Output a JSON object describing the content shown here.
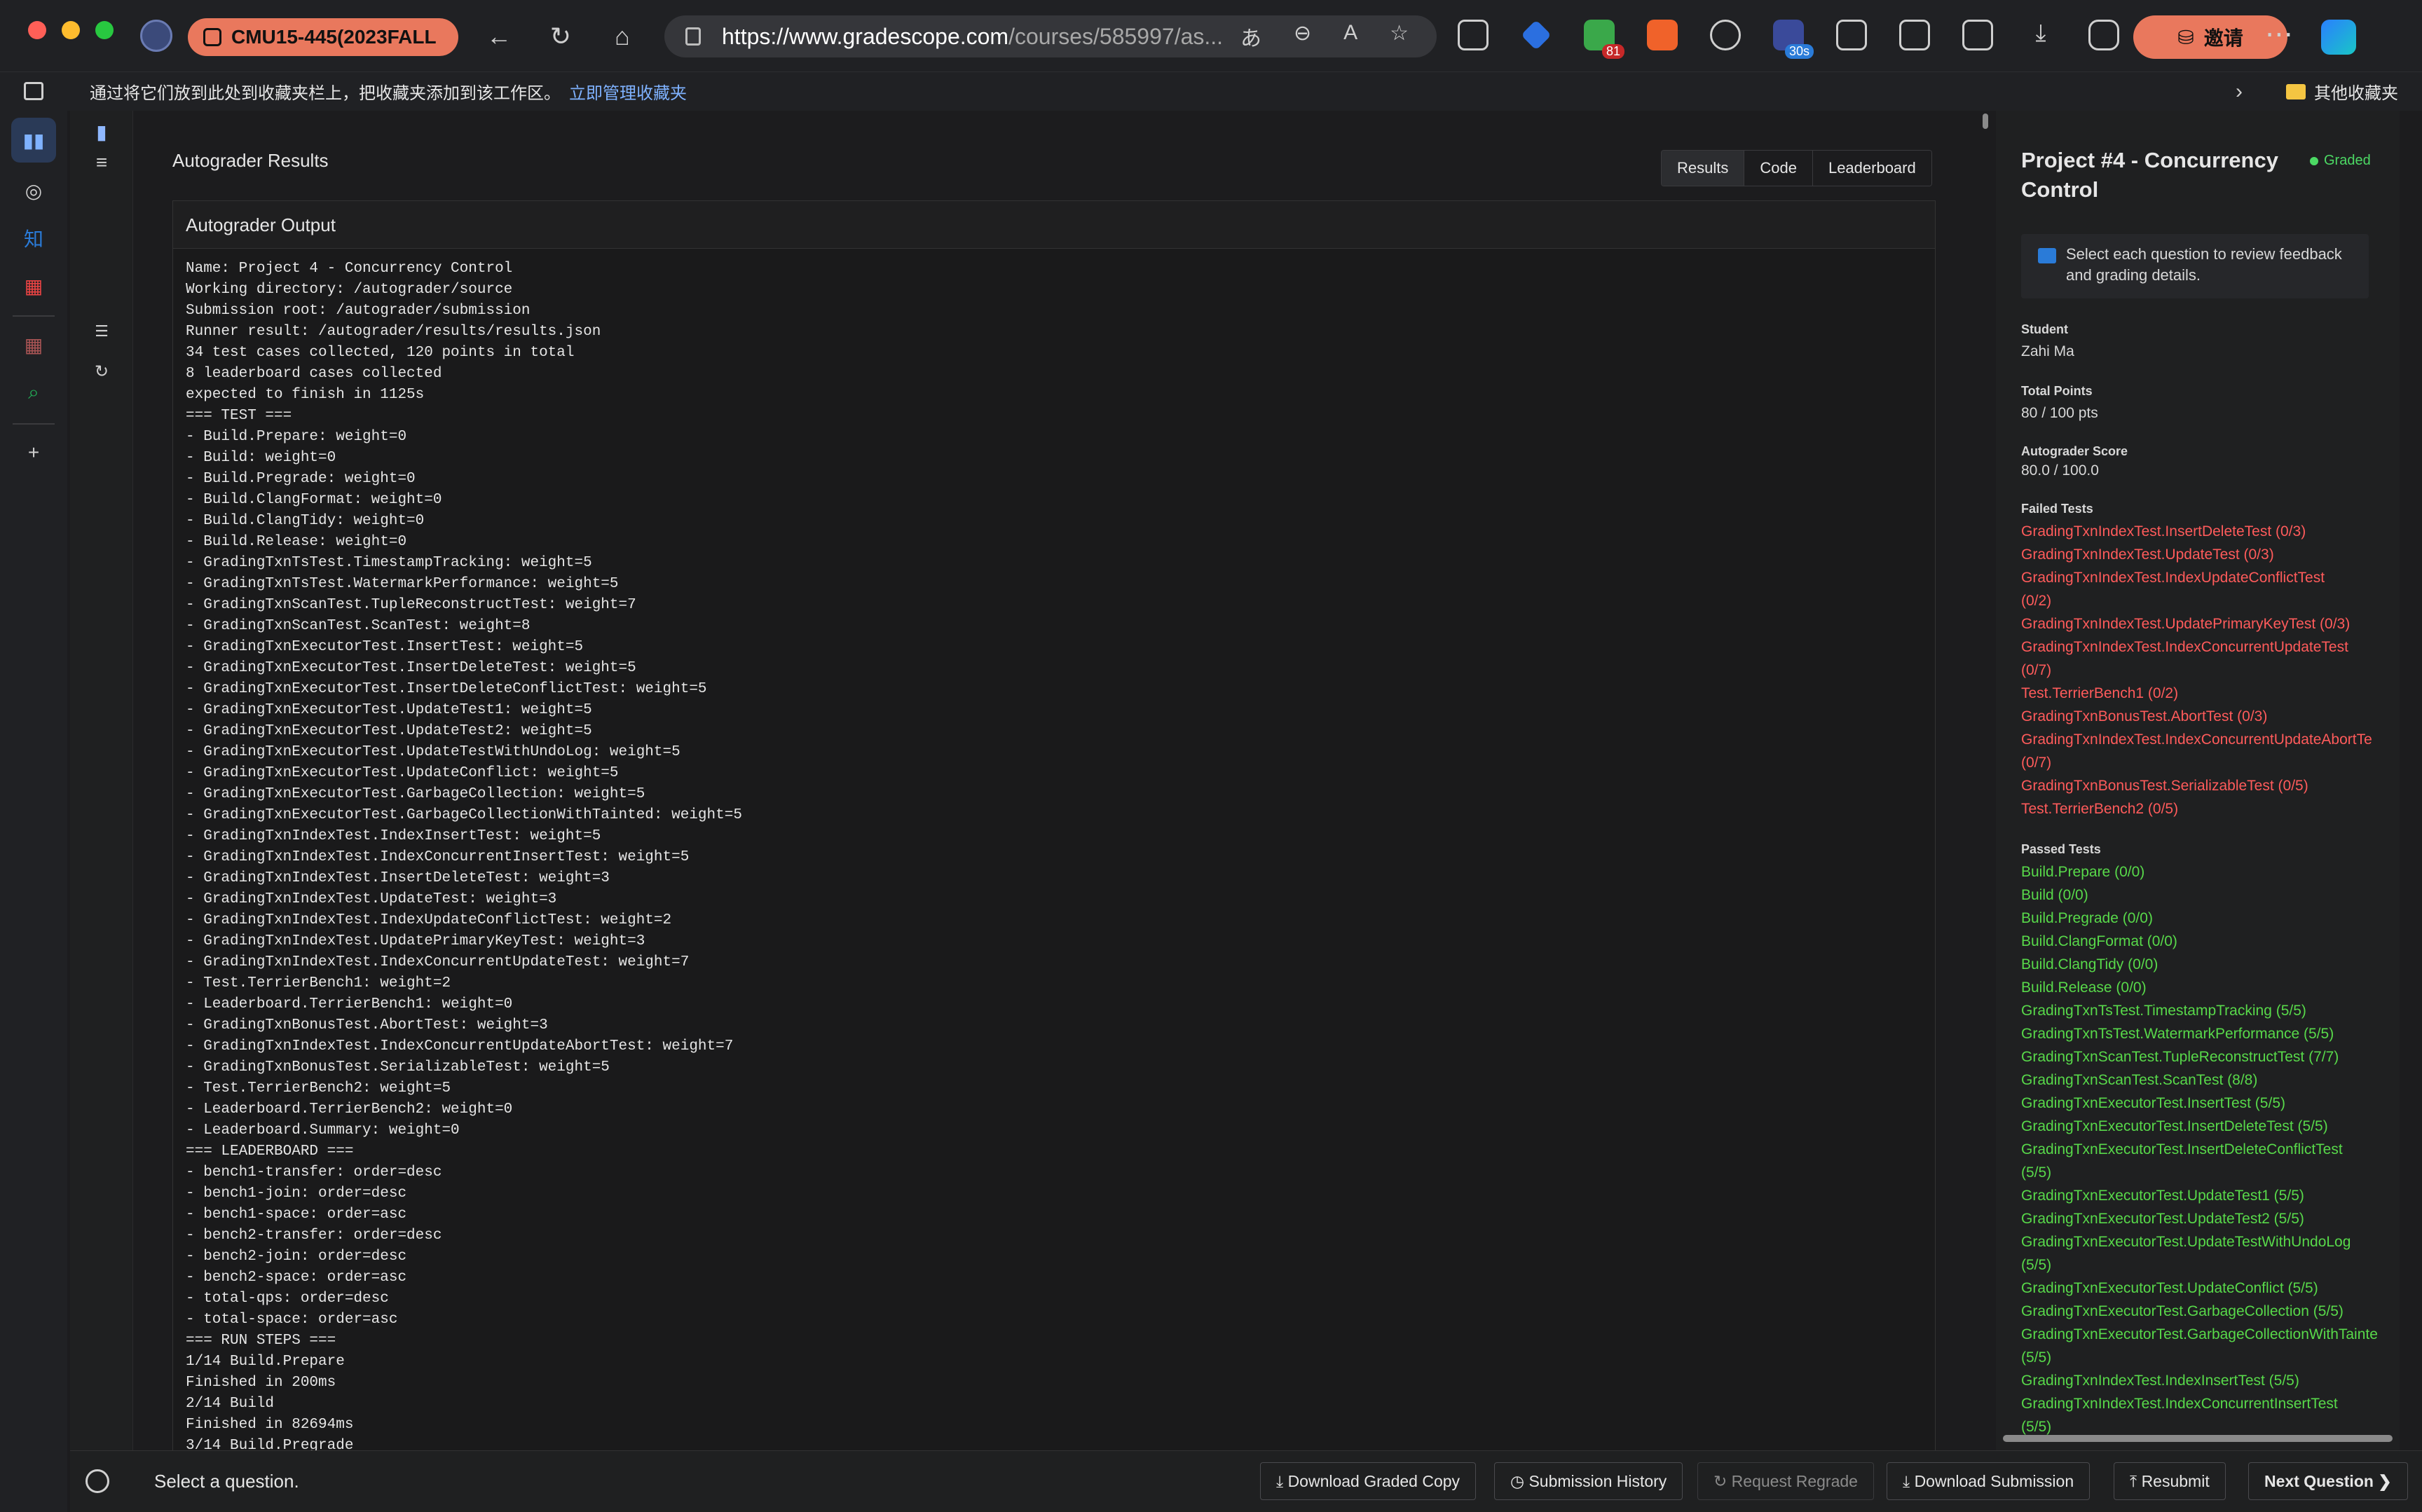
{
  "browser": {
    "tab_title": "CMU15-445(2023FALL",
    "url_host": "https://www.gradescope.com",
    "url_path": "/courses/585997/as...",
    "ext_badge": "81",
    "ext_timer": "30s",
    "invite_label": "邀请"
  },
  "favorites": {
    "message": "通过将它们放到此处到收藏夹栏上，把收藏夹添加到该工作区。",
    "manage_link": "立即管理收藏夹",
    "other_folder": "其他收藏夹"
  },
  "main": {
    "title": "Autograder Results",
    "tabs": [
      {
        "label": "Results"
      },
      {
        "label": "Code"
      },
      {
        "label": "Leaderboard"
      }
    ],
    "panel_title": "Autograder Output",
    "output_lines": [
      "Name: Project 4 - Concurrency Control",
      "Working directory: /autograder/source",
      "Submission root: /autograder/submission",
      "Runner result: /autograder/results/results.json",
      "34 test cases collected, 120 points in total",
      "8 leaderboard cases collected",
      "expected to finish in 1125s",
      "=== TEST ===",
      "- Build.Prepare: weight=0",
      "- Build: weight=0",
      "- Build.Pregrade: weight=0",
      "- Build.ClangFormat: weight=0",
      "- Build.ClangTidy: weight=0",
      "- Build.Release: weight=0",
      "- GradingTxnTsTest.TimestampTracking: weight=5",
      "- GradingTxnTsTest.WatermarkPerformance: weight=5",
      "- GradingTxnScanTest.TupleReconstructTest: weight=7",
      "- GradingTxnScanTest.ScanTest: weight=8",
      "- GradingTxnExecutorTest.InsertTest: weight=5",
      "- GradingTxnExecutorTest.InsertDeleteTest: weight=5",
      "- GradingTxnExecutorTest.InsertDeleteConflictTest: weight=5",
      "- GradingTxnExecutorTest.UpdateTest1: weight=5",
      "- GradingTxnExecutorTest.UpdateTest2: weight=5",
      "- GradingTxnExecutorTest.UpdateTestWithUndoLog: weight=5",
      "- GradingTxnExecutorTest.UpdateConflict: weight=5",
      "- GradingTxnExecutorTest.GarbageCollection: weight=5",
      "- GradingTxnExecutorTest.GarbageCollectionWithTainted: weight=5",
      "- GradingTxnIndexTest.IndexInsertTest: weight=5",
      "- GradingTxnIndexTest.IndexConcurrentInsertTest: weight=5",
      "- GradingTxnIndexTest.InsertDeleteTest: weight=3",
      "- GradingTxnIndexTest.UpdateTest: weight=3",
      "- GradingTxnIndexTest.IndexUpdateConflictTest: weight=2",
      "- GradingTxnIndexTest.UpdatePrimaryKeyTest: weight=3",
      "- GradingTxnIndexTest.IndexConcurrentUpdateTest: weight=7",
      "- Test.TerrierBench1: weight=2",
      "- Leaderboard.TerrierBench1: weight=0",
      "- GradingTxnBonusTest.AbortTest: weight=3",
      "- GradingTxnIndexTest.IndexConcurrentUpdateAbortTest: weight=7",
      "- GradingTxnBonusTest.SerializableTest: weight=5",
      "- Test.TerrierBench2: weight=5",
      "- Leaderboard.TerrierBench2: weight=0",
      "- Leaderboard.Summary: weight=0",
      "=== LEADERBOARD ===",
      "- bench1-transfer: order=desc",
      "- bench1-join: order=desc",
      "- bench1-space: order=asc",
      "- bench2-transfer: order=desc",
      "- bench2-join: order=desc",
      "- bench2-space: order=asc",
      "- total-qps: order=desc",
      "- total-space: order=asc",
      "=== RUN STEPS ===",
      "1/14 Build.Prepare",
      "Finished in 200ms",
      "2/14 Build",
      "Finished in 82694ms",
      "3/14 Build.Pregrade"
    ]
  },
  "side": {
    "title": "Project #4 - Concurrency Control",
    "status": "Graded",
    "notice": "Select each question to review feedback and grading details.",
    "student_label": "Student",
    "student_value": "Zahi Ma",
    "total_label": "Total Points",
    "total_value": "80 / 100 pts",
    "autograder_label": "Autograder Score",
    "autograder_value": "80.0 / 100.0",
    "failed_label": "Failed Tests",
    "failed_tests": [
      "GradingTxnIndexTest.InsertDeleteTest (0/3)",
      "GradingTxnIndexTest.UpdateTest (0/3)",
      "GradingTxnIndexTest.IndexUpdateConflictTest",
      "(0/2)",
      "GradingTxnIndexTest.UpdatePrimaryKeyTest (0/3)",
      "GradingTxnIndexTest.IndexConcurrentUpdateTest",
      "(0/7)",
      "Test.TerrierBench1 (0/2)",
      "GradingTxnBonusTest.AbortTest (0/3)",
      "GradingTxnIndexTest.IndexConcurrentUpdateAbortTe",
      "(0/7)",
      "GradingTxnBonusTest.SerializableTest (0/5)",
      "Test.TerrierBench2 (0/5)"
    ],
    "passed_label": "Passed Tests",
    "passed_tests": [
      "Build.Prepare (0/0)",
      "Build (0/0)",
      "Build.Pregrade (0/0)",
      "Build.ClangFormat (0/0)",
      "Build.ClangTidy (0/0)",
      "Build.Release (0/0)",
      "GradingTxnTsTest.TimestampTracking (5/5)",
      "GradingTxnTsTest.WatermarkPerformance (5/5)",
      "GradingTxnScanTest.TupleReconstructTest (7/7)",
      "GradingTxnScanTest.ScanTest (8/8)",
      "GradingTxnExecutorTest.InsertTest (5/5)",
      "GradingTxnExecutorTest.InsertDeleteTest (5/5)",
      "GradingTxnExecutorTest.InsertDeleteConflictTest",
      "(5/5)",
      "GradingTxnExecutorTest.UpdateTest1 (5/5)",
      "GradingTxnExecutorTest.UpdateTest2 (5/5)",
      "GradingTxnExecutorTest.UpdateTestWithUndoLog",
      "(5/5)",
      "GradingTxnExecutorTest.UpdateConflict (5/5)",
      "GradingTxnExecutorTest.GarbageCollection (5/5)",
      "GradingTxnExecutorTest.GarbageCollectionWithTainte",
      "(5/5)",
      "GradingTxnIndexTest.IndexInsertTest (5/5)",
      "GradingTxnIndexTest.IndexConcurrentInsertTest",
      "(5/5)"
    ]
  },
  "bottom": {
    "select_prompt": "Select a question.",
    "download_graded": "Download Graded Copy",
    "submission_history": "Submission History",
    "request_regrade": "Request Regrade",
    "download_submission": "Download Submission",
    "resubmit": "Resubmit",
    "next_question": "Next Question"
  },
  "icons": {
    "download": "⤓",
    "clock": "◷",
    "regrade": "↻",
    "upload": "⤒",
    "chevron_right": "❯"
  }
}
